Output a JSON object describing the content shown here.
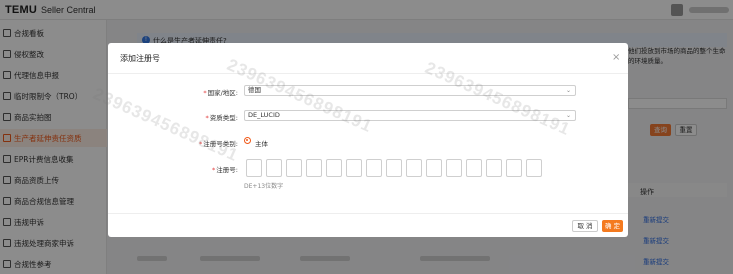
{
  "topbar": {
    "brand": "TEMU",
    "subtitle": "Seller Central"
  },
  "sidebar": {
    "items": [
      {
        "label": "合规看板"
      },
      {
        "label": "侵权整改"
      },
      {
        "label": "代理信息申报"
      },
      {
        "label": "临时限制令（TRO）"
      },
      {
        "label": "商品实拍图"
      },
      {
        "label": "生产者延伸责任资质"
      },
      {
        "label": "EPR计费信息收集"
      },
      {
        "label": "商品资质上传"
      },
      {
        "label": "商品合规信息管理"
      },
      {
        "label": "违规申诉"
      },
      {
        "label": "违规处理商家申诉"
      },
      {
        "label": "合规性参考"
      }
    ],
    "active_index": 5
  },
  "background": {
    "banner_text": "什么是生产者延伸责任?",
    "right_text_1": "他们投放到市场的商品的整个生命",
    "right_text_2": "的环境质量。",
    "query_button": "查询",
    "reset_button": "重置",
    "op_header": "操作",
    "links": [
      "重新提交",
      "重新提交",
      "重新提交"
    ]
  },
  "modal": {
    "title": "添加注册号",
    "close": "×",
    "fields": {
      "country_label": "国家/地区:",
      "country_value": "德国",
      "qual_type_label": "资质类型:",
      "qual_type_value": "DE_LUCID",
      "reg_type_label": "注册号类别:",
      "reg_type_value": "主体",
      "reg_no_label": "注册号:",
      "reg_no_hint": "DE+13位数字"
    },
    "cancel": "取 消",
    "ok": "确 定"
  },
  "watermark": "239639456898191",
  "colors": {
    "accent": "#f05a1a",
    "link": "#2f6de1",
    "banner": "#e9f1fc"
  },
  "icons": {
    "select_chevron": "chevron-down-icon",
    "info": "info-icon"
  }
}
